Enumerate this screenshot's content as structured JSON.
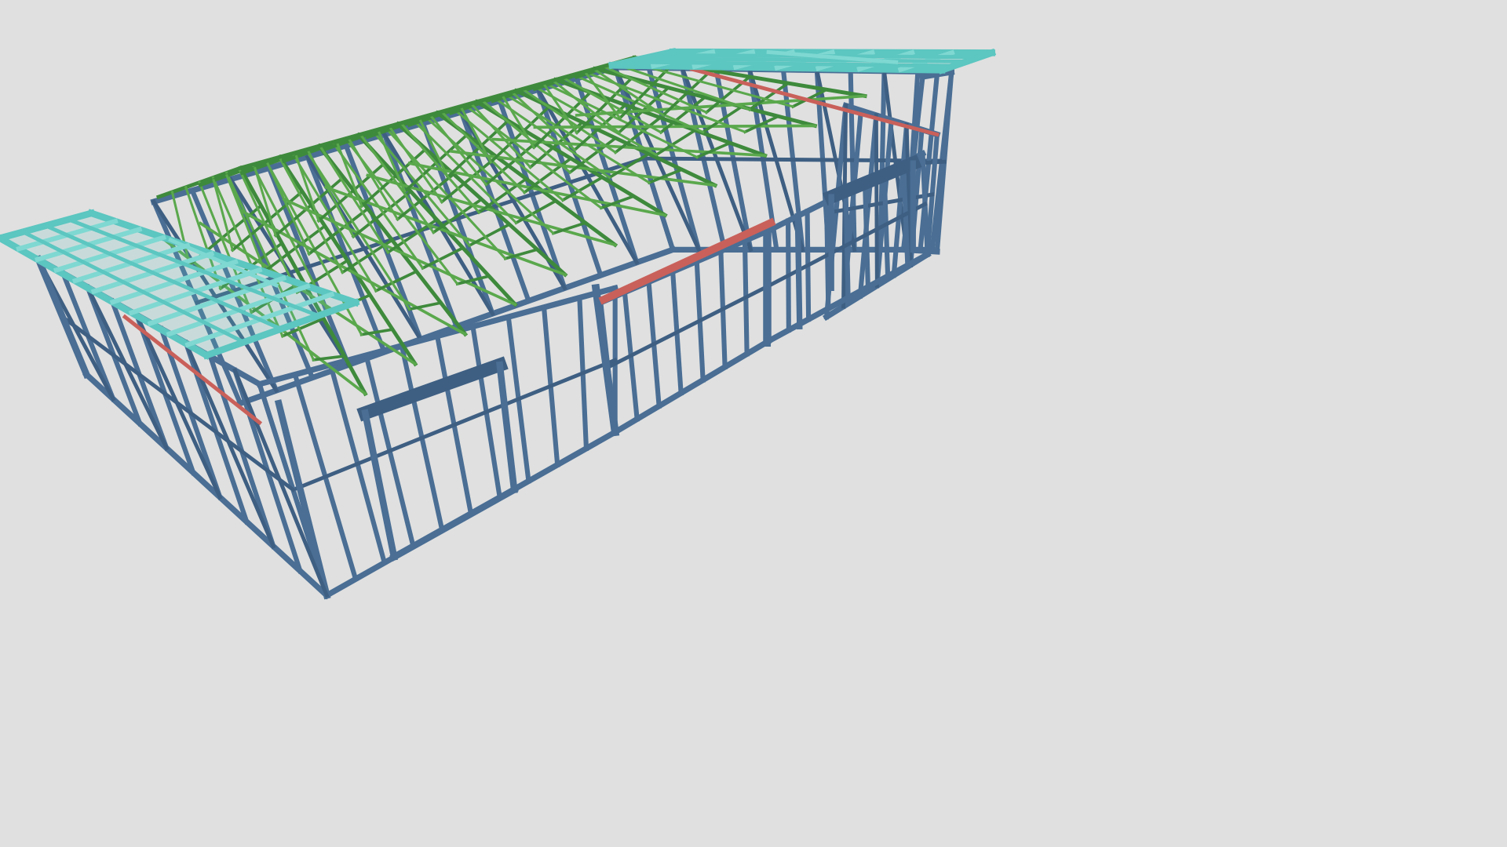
{
  "viewer": {
    "background_color": "#e0e0e0"
  },
  "model": {
    "colors": {
      "wall_frame": "#4a6e94",
      "wall_frame_dark": "#3e5f82",
      "roof_truss": "#3e8a3c",
      "roof_truss_light": "#5aa84c",
      "eave_panel": "#5cc6c0",
      "eave_panel_light": "#7fd8d2",
      "beam_highlight": "#c9605a"
    },
    "icons": {
      "wall": "steel-wall-frame-icon",
      "truss": "roof-truss-icon",
      "eave": "eave-panel-icon",
      "beam": "beam-icon"
    }
  }
}
